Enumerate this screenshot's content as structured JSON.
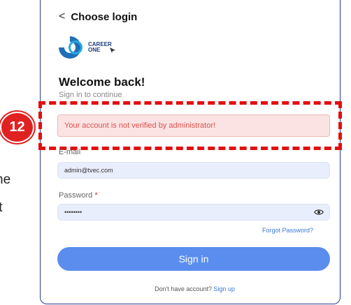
{
  "side_text": [
    "ne",
    "it"
  ],
  "header": {
    "back_label": "Choose login"
  },
  "logo": {
    "line1": "CAREER",
    "line2": "ONE"
  },
  "welcome": {
    "title": "Welcome back!",
    "subtitle": "Sign in to continue"
  },
  "alert": {
    "message": "Your account is not verified by administrator!"
  },
  "annotation": {
    "badge": "12"
  },
  "form": {
    "email_label": "E-mail",
    "email_value": "admin@tvec.com",
    "password_label": "Password",
    "password_required": "*",
    "password_value": "••••••••",
    "forgot_label": "Forgot Password?",
    "signin_label": "Sign in"
  },
  "footer": {
    "prompt": "Don't have account?",
    "signup_label": "Sign up"
  },
  "colors": {
    "accent": "#5b8def",
    "alert_bg": "#fbe3e3",
    "alert_text": "#d9534f",
    "annotation_red": "#e20f0f"
  }
}
